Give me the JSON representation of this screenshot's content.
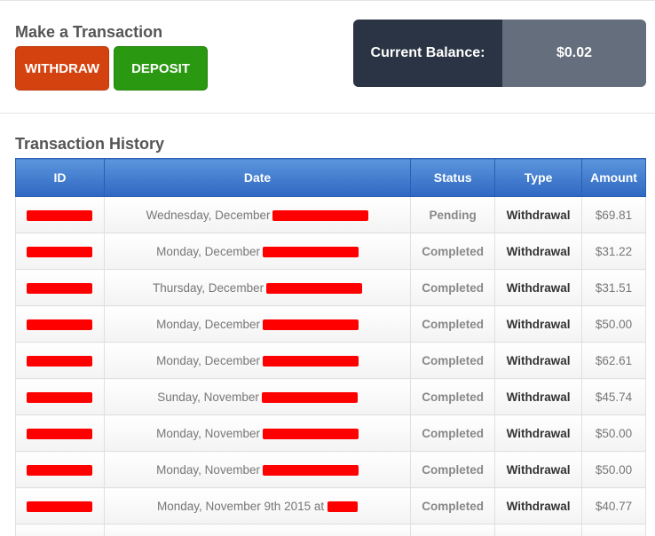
{
  "actions": {
    "title": "Make a Transaction",
    "withdraw_label": "WITHDRAW",
    "deposit_label": "DEPOSIT",
    "withdraw_color": "#d4430f",
    "deposit_color": "#2a9810"
  },
  "balance": {
    "label": "Current Balance:",
    "value": "$0.02"
  },
  "history": {
    "title": "Transaction History",
    "columns": [
      "ID",
      "Date",
      "Status",
      "Type",
      "Amount"
    ],
    "rows": [
      {
        "date": "Wednesday, December",
        "status": "Pending",
        "type": "Withdrawal",
        "amount": "$69.81"
      },
      {
        "date": "Monday, December",
        "status": "Completed",
        "type": "Withdrawal",
        "amount": "$31.22"
      },
      {
        "date": "Thursday, December",
        "status": "Completed",
        "type": "Withdrawal",
        "amount": "$31.51"
      },
      {
        "date": "Monday, December",
        "status": "Completed",
        "type": "Withdrawal",
        "amount": "$50.00"
      },
      {
        "date": "Monday, December",
        "status": "Completed",
        "type": "Withdrawal",
        "amount": "$62.61"
      },
      {
        "date": "Sunday, November",
        "status": "Completed",
        "type": "Withdrawal",
        "amount": "$45.74"
      },
      {
        "date": "Monday, November",
        "status": "Completed",
        "type": "Withdrawal",
        "amount": "$50.00"
      },
      {
        "date": "Monday, November",
        "status": "Completed",
        "type": "Withdrawal",
        "amount": "$50.00"
      },
      {
        "date": "Monday, November 9th 2015 at",
        "status": "Completed",
        "type": "Withdrawal",
        "amount": "$40.77"
      }
    ]
  }
}
